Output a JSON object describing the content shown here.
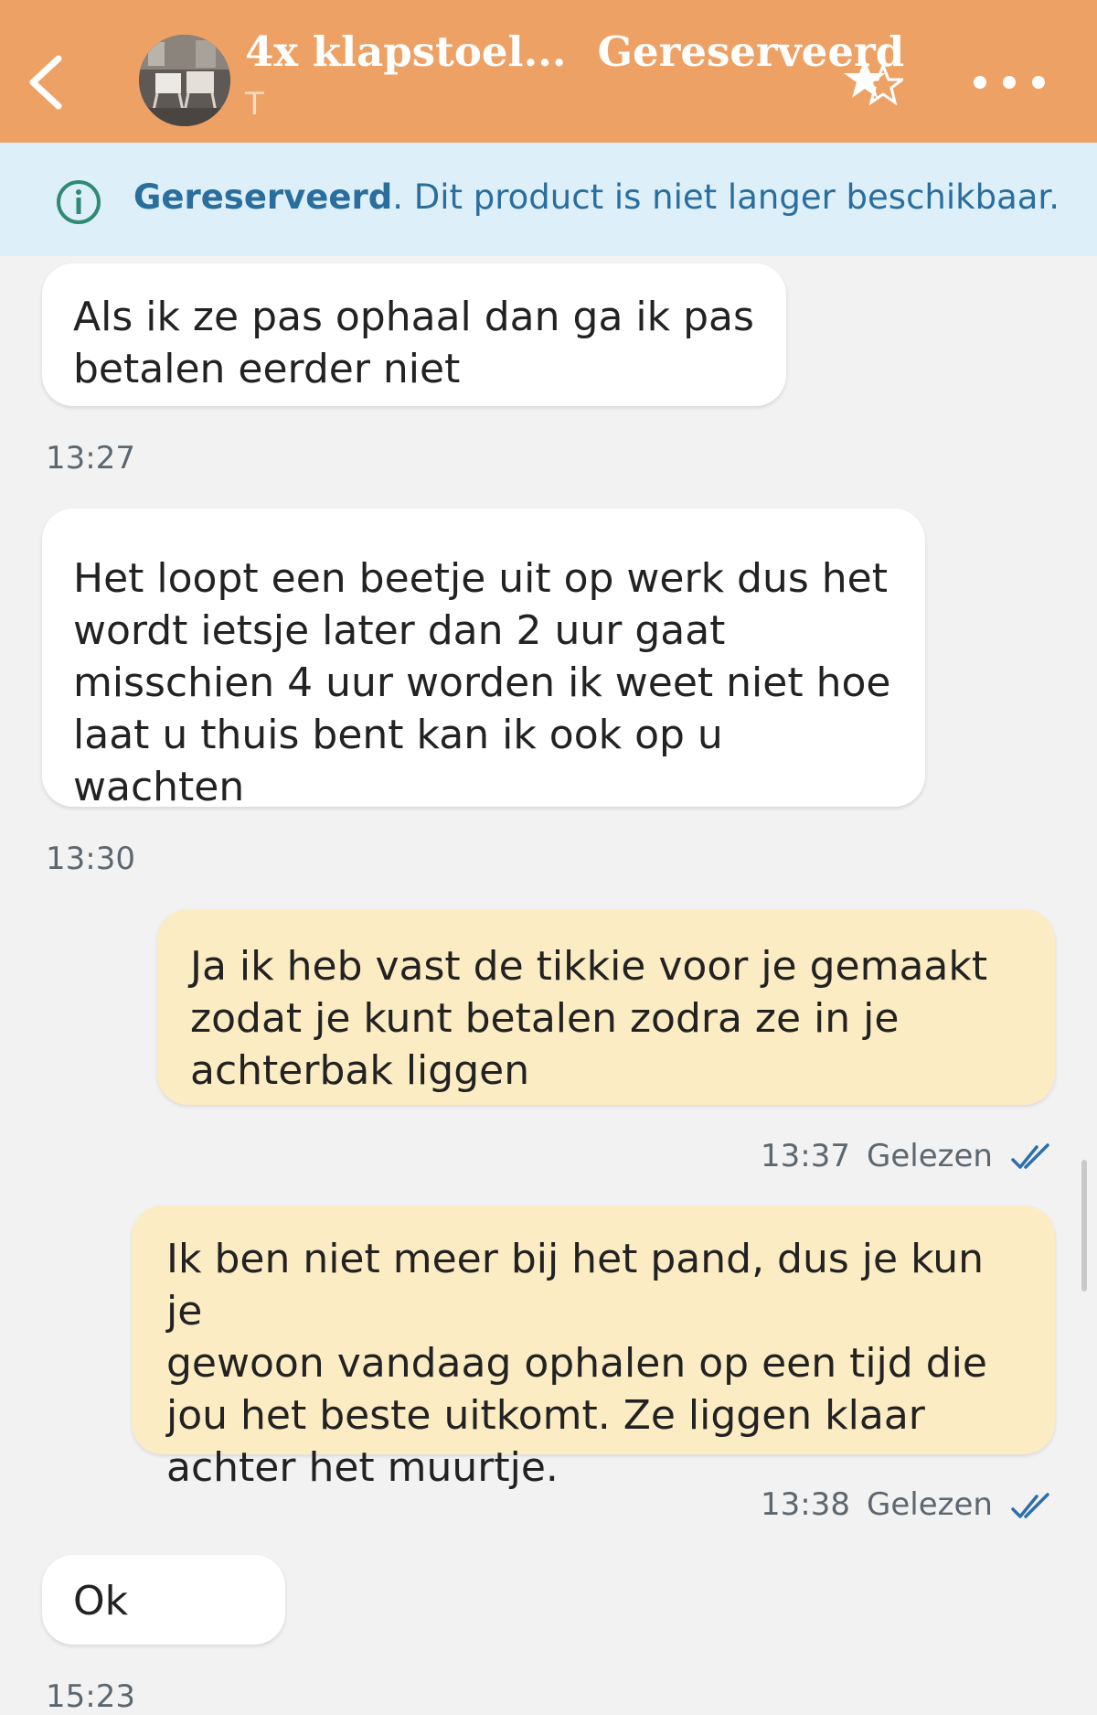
{
  "header": {
    "title": "4x klapstoel...",
    "status": "Gereserveerd",
    "subtitle": "T",
    "back_icon": "chevron-left-icon",
    "star_icon": "star-rate-icon",
    "more_icon": "more-dots-icon"
  },
  "banner": {
    "icon": "info-icon",
    "status": "Gereserveerd",
    "text": ". Dit product is niet langer beschikbaar."
  },
  "messages": [
    {
      "direction": "in",
      "lines": [
        "Als ik ze pas ophaal dan ga ik pas",
        "betalen eerder niet"
      ],
      "time": "13:27"
    },
    {
      "direction": "in",
      "lines": [
        "Het loopt een beetje uit op werk dus het",
        "wordt ietsje later dan 2 uur gaat",
        "misschien 4 uur worden ik weet niet hoe",
        "laat u thuis bent kan ik ook op u wachten"
      ],
      "time": "13:30"
    },
    {
      "direction": "out",
      "lines": [
        "Ja ik heb vast de tikkie voor je gemaakt",
        "zodat je kunt betalen zodra ze in je",
        "achterbak liggen"
      ],
      "time": "13:37",
      "status": "Gelezen"
    },
    {
      "direction": "out",
      "lines": [
        "Ik ben niet meer bij het pand, dus je kun je",
        "gewoon vandaag ophalen op een tijd die",
        "jou het beste uitkomt. Ze liggen klaar",
        "achter het muurtje."
      ],
      "time": "13:38",
      "status": "Gelezen"
    },
    {
      "direction": "in",
      "lines": [
        "Ok"
      ],
      "time": "15:23"
    }
  ],
  "colors": {
    "header": "#eda165",
    "banner": "#ddeff8",
    "banner_text": "#2a6e9d",
    "outgoing_bubble": "#fcecc3",
    "incoming_bubble": "#ffffff",
    "read_check": "#2f6fa8"
  }
}
